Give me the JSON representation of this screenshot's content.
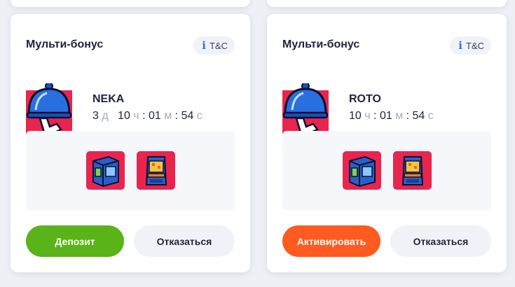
{
  "cards": [
    {
      "title": "Мульти-бонус",
      "tc_icon": "i",
      "tc_label": "T&C",
      "bonus_name": "NEKA",
      "timer": {
        "days": "3",
        "days_unit": "д",
        "hours": "10",
        "hours_unit": "ч",
        "minutes": "01",
        "minutes_unit": "м",
        "seconds": "54",
        "seconds_unit": "с"
      },
      "games": [
        "slot-machine-game-icon",
        "arcade-cabinet-game-icon"
      ],
      "primary_button": "Депозит",
      "secondary_button": "Отказаться",
      "primary_color": "#5bb31a"
    },
    {
      "title": "Мульти-бонус",
      "tc_icon": "i",
      "tc_label": "T&C",
      "bonus_name": "ROTO",
      "timer": {
        "hours": "10",
        "hours_unit": "ч",
        "minutes": "01",
        "minutes_unit": "м",
        "seconds": "54",
        "seconds_unit": "с"
      },
      "games": [
        "slot-machine-game-icon",
        "arcade-cabinet-game-icon"
      ],
      "primary_button": "Активировать",
      "secondary_button": "Отказаться",
      "primary_color": "#ff5a1f"
    }
  ]
}
